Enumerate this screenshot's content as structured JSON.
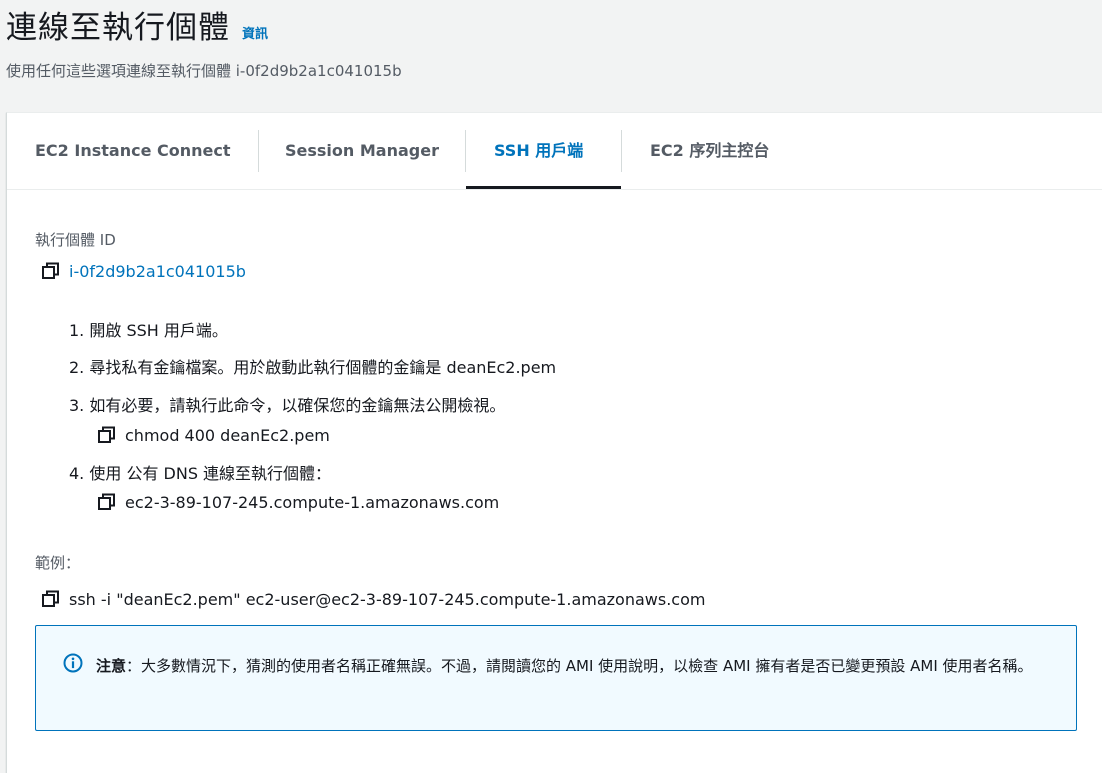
{
  "header": {
    "title": "連線至執行個體",
    "info_link": "資訊",
    "subtitle": "使用任何這些選項連線至執行個體 i-0f2d9b2a1c041015b"
  },
  "tabs": [
    {
      "label": "EC2 Instance Connect",
      "active": false
    },
    {
      "label": "Session Manager",
      "active": false
    },
    {
      "label": "SSH 用戶端",
      "active": true
    },
    {
      "label": "EC2 序列主控台",
      "active": false
    }
  ],
  "instance": {
    "label": "執行個體 ID",
    "id": "i-0f2d9b2a1c041015b"
  },
  "steps": [
    {
      "text": "1. 開啟 SSH 用戶端。"
    },
    {
      "text": "2. 尋找私有金鑰檔案。用於啟動此執行個體的金鑰是 deanEc2.pem"
    },
    {
      "text": "3. 如有必要，請執行此命令，以確保您的金鑰無法公開檢視。",
      "command": "chmod 400 deanEc2.pem"
    },
    {
      "text": "4. 使用 公有 DNS 連線至執行個體：",
      "command": "ec2-3-89-107-245.compute-1.amazonaws.com"
    }
  ],
  "example": {
    "label": "範例：",
    "command": "ssh -i \"deanEc2.pem\" ec2-user@ec2-3-89-107-245.compute-1.amazonaws.com"
  },
  "note": {
    "bold": "注意",
    "text": "：大多數情況下，猜測的使用者名稱正確無誤。不過，請閱讀您的 AMI 使用說明，以檢查 AMI 擁有者是否已變更預設 AMI 使用者名稱。"
  },
  "icons": {
    "copy": "copy-icon",
    "info": "info-icon"
  },
  "colors": {
    "accent": "#0073bb",
    "text": "#16191f",
    "muted": "#545b64",
    "note_bg": "#f1faff"
  }
}
